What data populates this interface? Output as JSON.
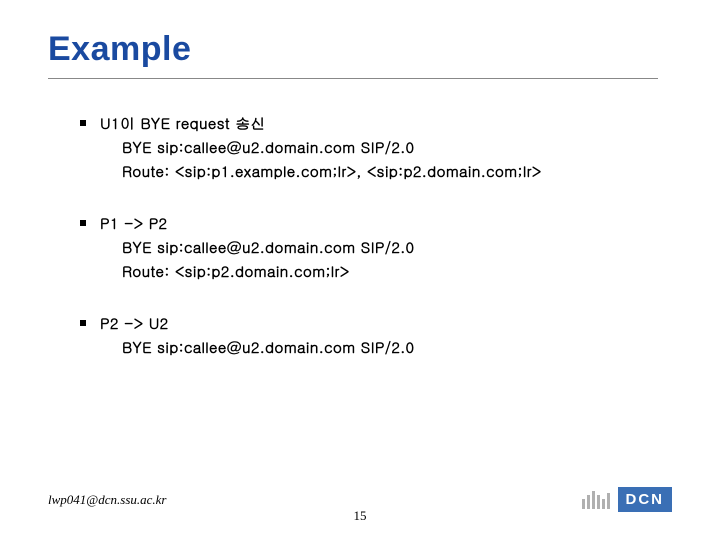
{
  "title": "Example",
  "bullets": [
    {
      "head": "U1이 BYE request 송신",
      "lines": [
        "BYE sip:callee@u2.domain.com SIP/2.0",
        "Route: <sip:p1.example.com;lr>, <sip:p2.domain.com;lr>"
      ]
    },
    {
      "head": "P1 -> P2",
      "lines": [
        "BYE sip:callee@u2.domain.com SIP/2.0",
        "Route: <sip:p2.domain.com;lr>"
      ]
    },
    {
      "head": "P2 -> U2",
      "lines": [
        "BYE sip:callee@u2.domain.com SIP/2.0"
      ]
    }
  ],
  "footer": {
    "email": "lwp041@dcn.ssu.ac.kr",
    "page": "15"
  },
  "logo": {
    "text": "DCN"
  }
}
